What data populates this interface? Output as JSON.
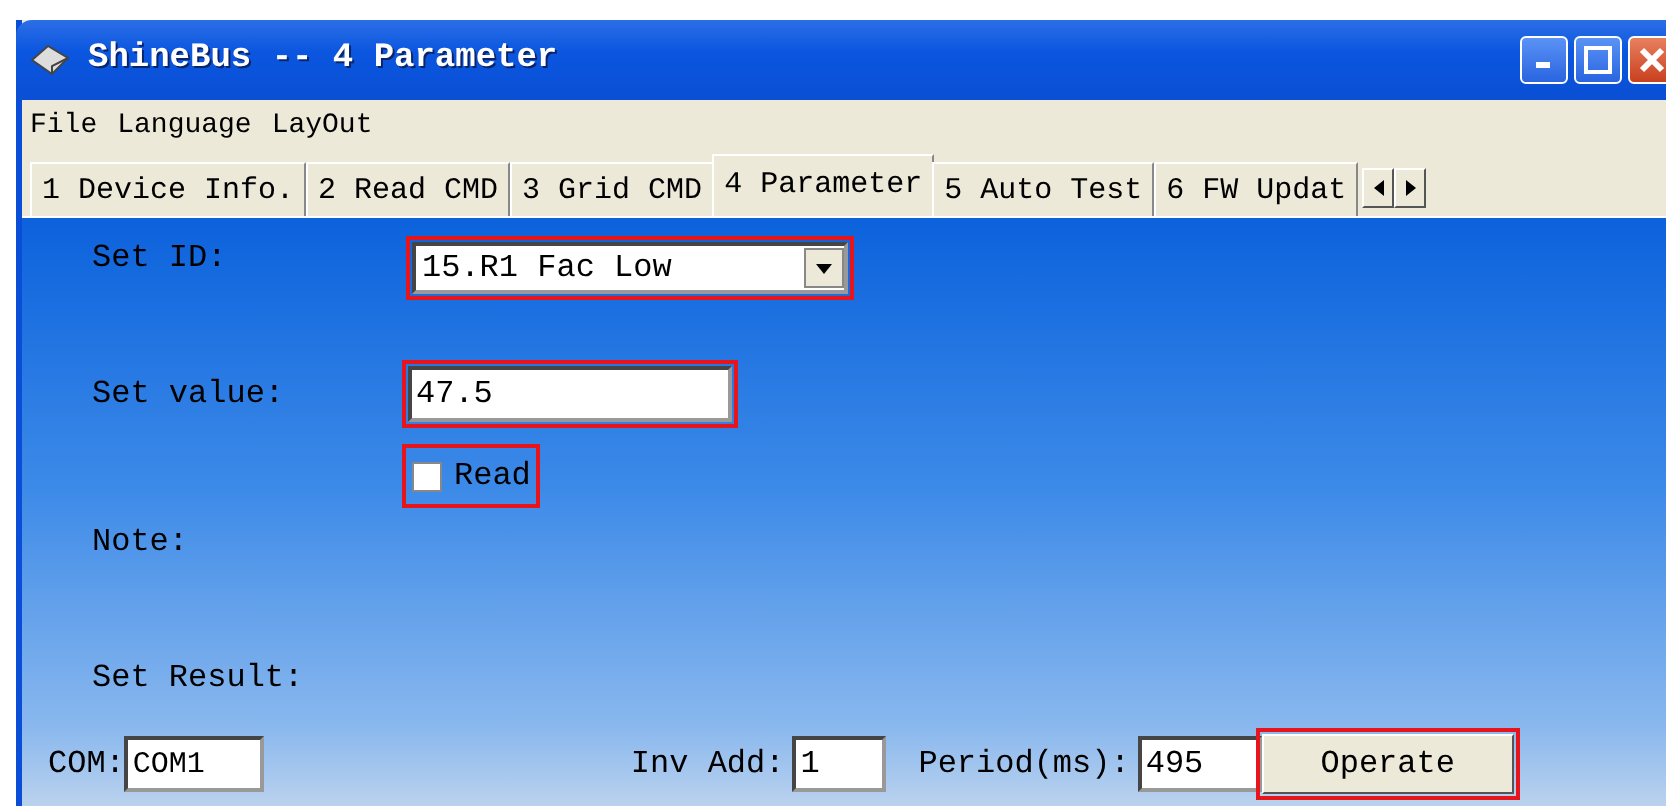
{
  "window": {
    "title": "ShineBus -- 4 Parameter"
  },
  "menu": [
    "File",
    "Language",
    "LayOut"
  ],
  "tabs": [
    {
      "label": "1 Device Info.",
      "selected": false
    },
    {
      "label": "2 Read CMD",
      "selected": false
    },
    {
      "label": "3 Grid CMD",
      "selected": false
    },
    {
      "label": "4 Parameter",
      "selected": true
    },
    {
      "label": "5 Auto Test",
      "selected": false
    },
    {
      "label": "6 FW Updat",
      "selected": false
    }
  ],
  "form": {
    "set_id": {
      "label": "Set ID:",
      "value": "15.R1 Fac Low",
      "highlighted": true
    },
    "set_value": {
      "label": "Set value:",
      "value": "47.5",
      "highlighted": true
    },
    "read": {
      "label": "Read",
      "checked": false,
      "highlighted": true
    },
    "note": {
      "label": "Note:"
    },
    "set_result": {
      "label": "Set Result:"
    }
  },
  "bottom": {
    "com": {
      "label": "COM:",
      "value": "COM1"
    },
    "inv_add": {
      "label": "Inv Add:",
      "value": "1"
    },
    "period": {
      "label": "Period(ms):",
      "value": "495"
    },
    "operate": {
      "label": "Operate",
      "highlighted": true
    }
  }
}
